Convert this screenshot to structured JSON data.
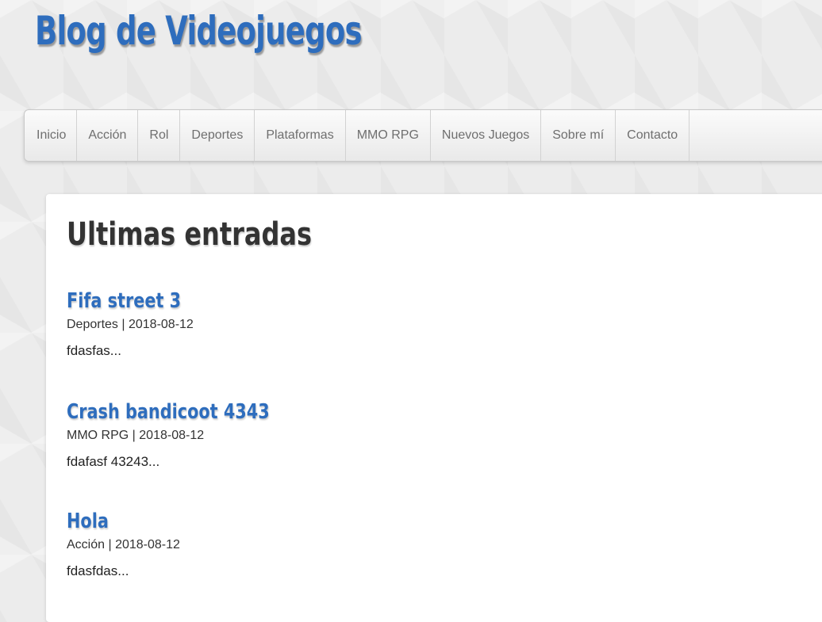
{
  "site": {
    "title": "Blog de Videojuegos"
  },
  "nav": {
    "items": [
      "Inicio",
      "Acción",
      "Rol",
      "Deportes",
      "Plataformas",
      "MMO RPG",
      "Nuevos Juegos",
      "Sobre mí",
      "Contacto"
    ]
  },
  "main": {
    "heading": "Ultimas entradas",
    "posts": [
      {
        "title": "Fifa street 3",
        "category": "Deportes",
        "date": "2018-08-12",
        "meta": "Deportes | 2018-08-12",
        "excerpt": "fdasfas..."
      },
      {
        "title": "Crash bandicoot 4343",
        "category": "MMO RPG",
        "date": "2018-08-12",
        "meta": "MMO RPG | 2018-08-12",
        "excerpt": "fdafasf 43243..."
      },
      {
        "title": "Hola",
        "category": "Acción",
        "date": "2018-08-12",
        "meta": "Acción | 2018-08-12",
        "excerpt": "fdasfdas..."
      }
    ]
  },
  "colors": {
    "accent": "#2e6dbd",
    "heading": "#333333",
    "nav_text": "#6f6f6f",
    "background": "#ececec"
  }
}
